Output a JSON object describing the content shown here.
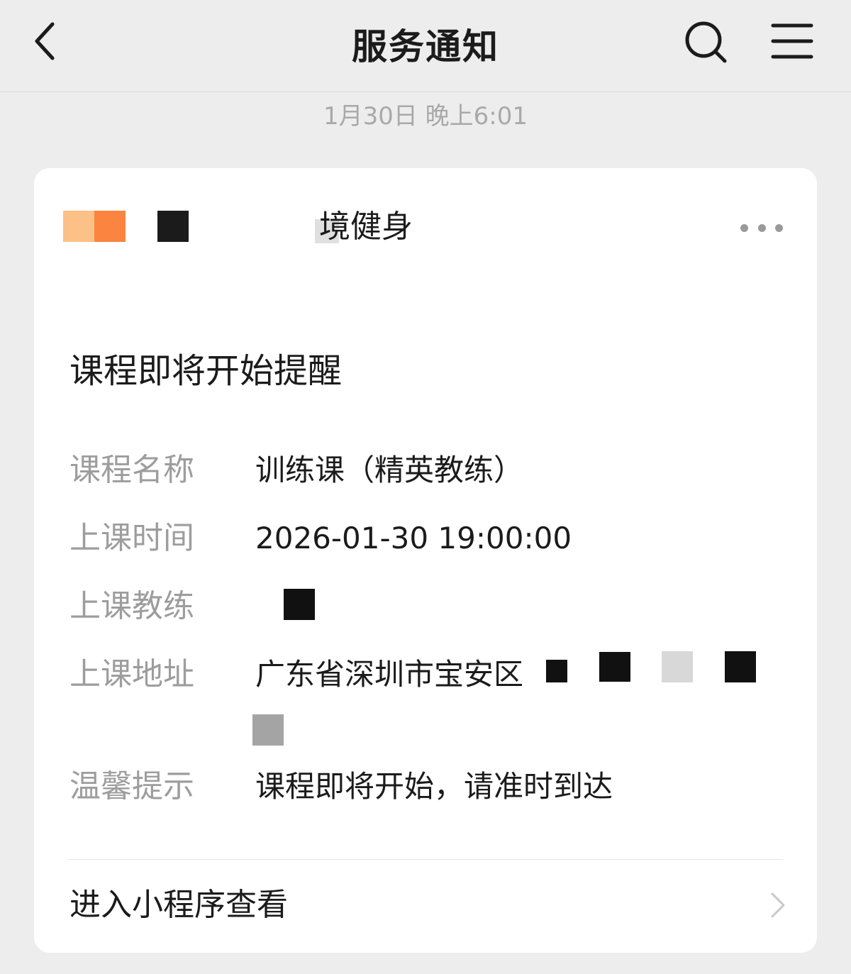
{
  "header": {
    "title": "服务通知",
    "back_icon": "chevron-left-icon",
    "search_icon": "search-icon",
    "menu_icon": "hamburger-menu-icon"
  },
  "message": {
    "timestamp": "1月30日 晚上6:01"
  },
  "card": {
    "brand_name": "境健身",
    "more_icon": "more-dots-icon",
    "notice_title": "课程即将开始提醒",
    "fields": [
      {
        "label": "课程名称",
        "value": "训练课（精英教练）"
      },
      {
        "label": "上课时间",
        "value": "2026-01-30 19:00:00"
      },
      {
        "label": "上课教练",
        "value": ""
      },
      {
        "label": "上课地址",
        "value": "广东省深圳市宝安区"
      },
      {
        "label": "温馨提示",
        "value": "课程即将开始，请准时到达"
      }
    ],
    "footer_link": "进入小程序查看",
    "footer_icon": "chevron-right-icon"
  },
  "colors": {
    "page_bg": "#ededed",
    "card_bg": "#ffffff",
    "label_gray": "#9d9d9d",
    "text_dark": "#1b1b1b",
    "logo_light": "#fdc086",
    "logo_dark": "#fb8440"
  }
}
